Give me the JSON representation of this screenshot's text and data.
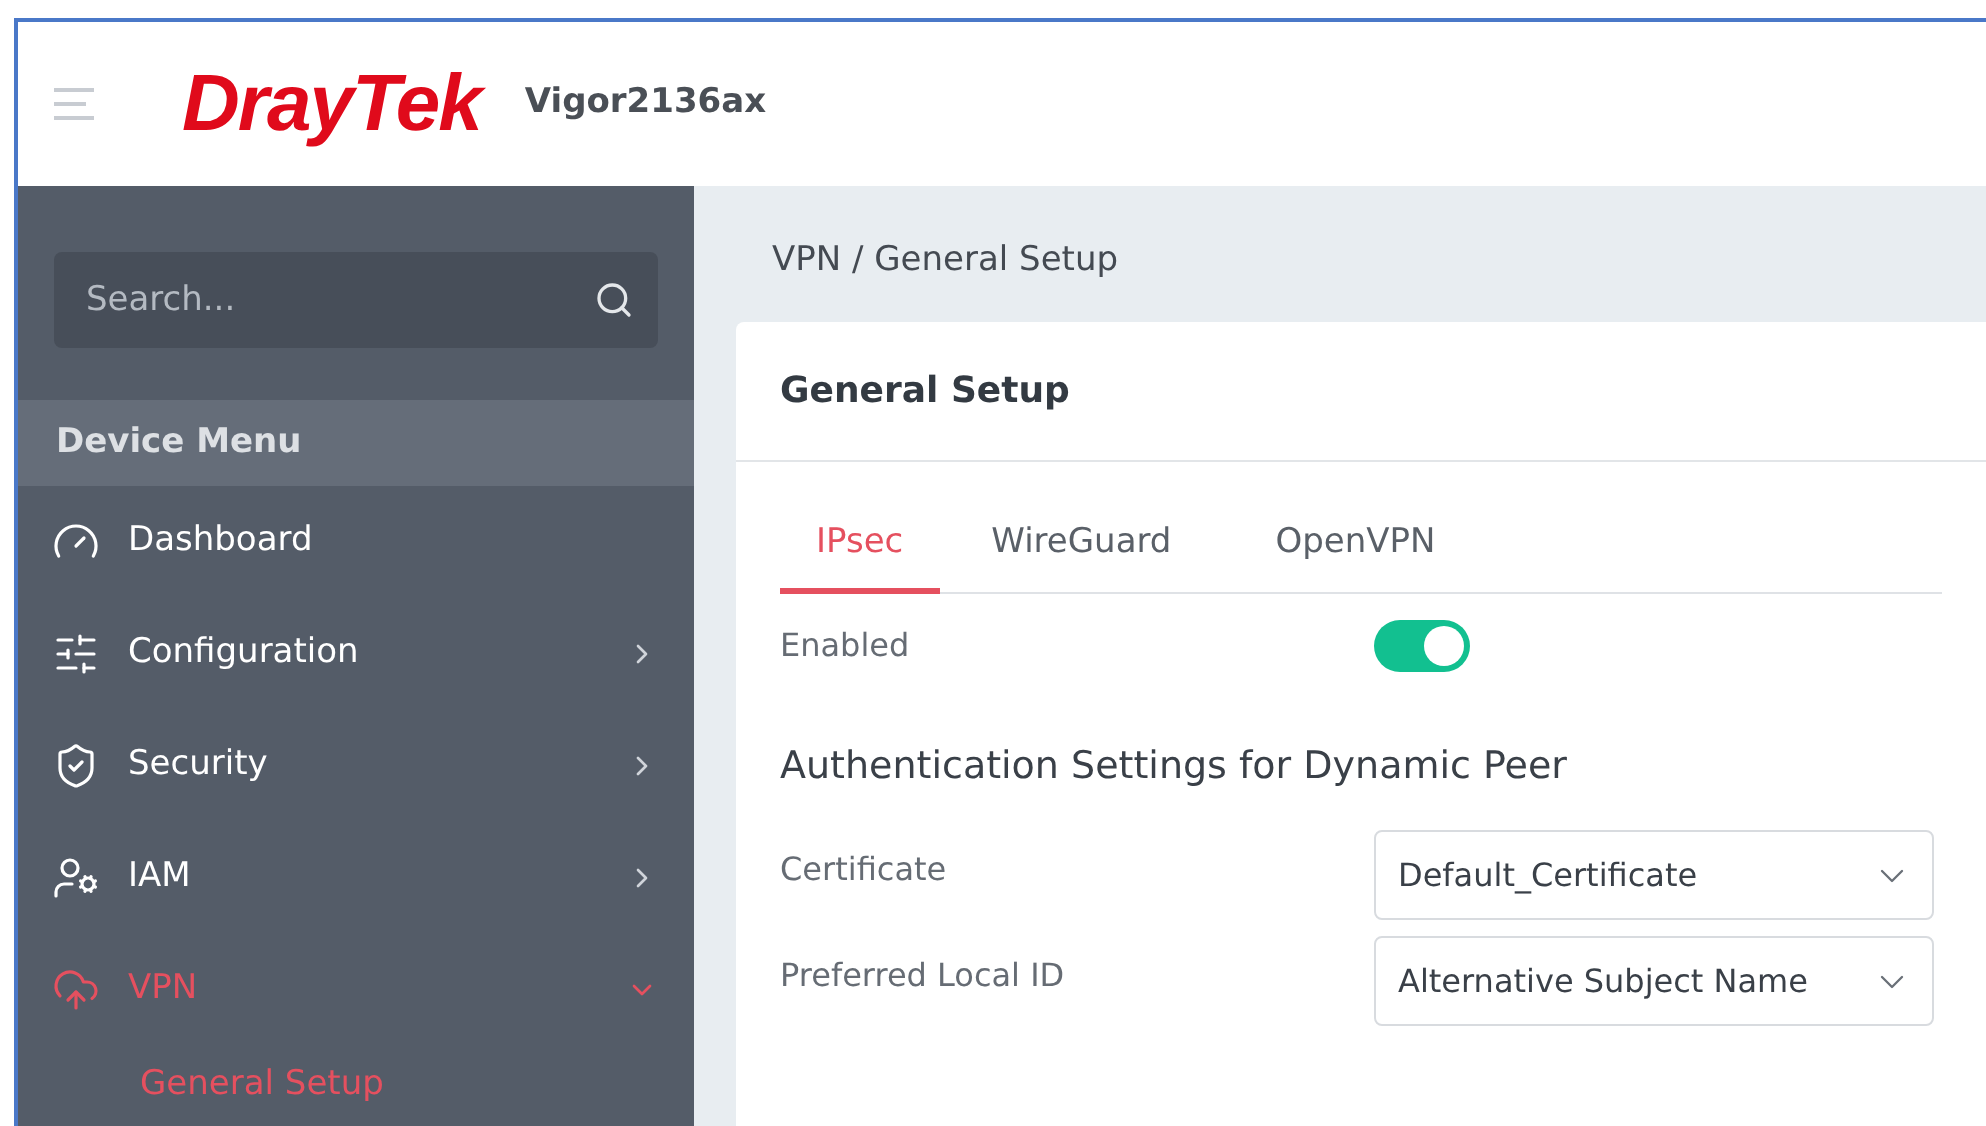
{
  "header": {
    "logo": "DrayTek",
    "model": "Vigor2136ax"
  },
  "sidebar": {
    "search": {
      "placeholder": "Search..."
    },
    "section": "Device Menu",
    "items": [
      {
        "label": "Dashboard",
        "kind": "link",
        "selected": false
      },
      {
        "label": "Configuration",
        "kind": "group",
        "expanded": false,
        "selected": false
      },
      {
        "label": "Security",
        "kind": "group",
        "expanded": false,
        "selected": false
      },
      {
        "label": "IAM",
        "kind": "group",
        "expanded": false,
        "selected": false
      },
      {
        "label": "VPN",
        "kind": "group",
        "expanded": true,
        "selected": true,
        "children": [
          {
            "label": "General Setup",
            "selected": true
          }
        ]
      }
    ]
  },
  "breadcrumb": "VPN / General Setup",
  "card": {
    "title": "General Setup",
    "tabs": [
      {
        "label": "IPsec",
        "selected": true
      },
      {
        "label": "WireGuard",
        "selected": false
      },
      {
        "label": "OpenVPN",
        "selected": false
      }
    ],
    "enabled": {
      "label": "Enabled",
      "on": true
    },
    "section_title": "Authentication Settings for Dynamic Peer",
    "fields": [
      {
        "label": "Certificate",
        "value": "Default_Certificate"
      },
      {
        "label": "Preferred Local ID",
        "value": "Alternative Subject Name"
      }
    ]
  }
}
